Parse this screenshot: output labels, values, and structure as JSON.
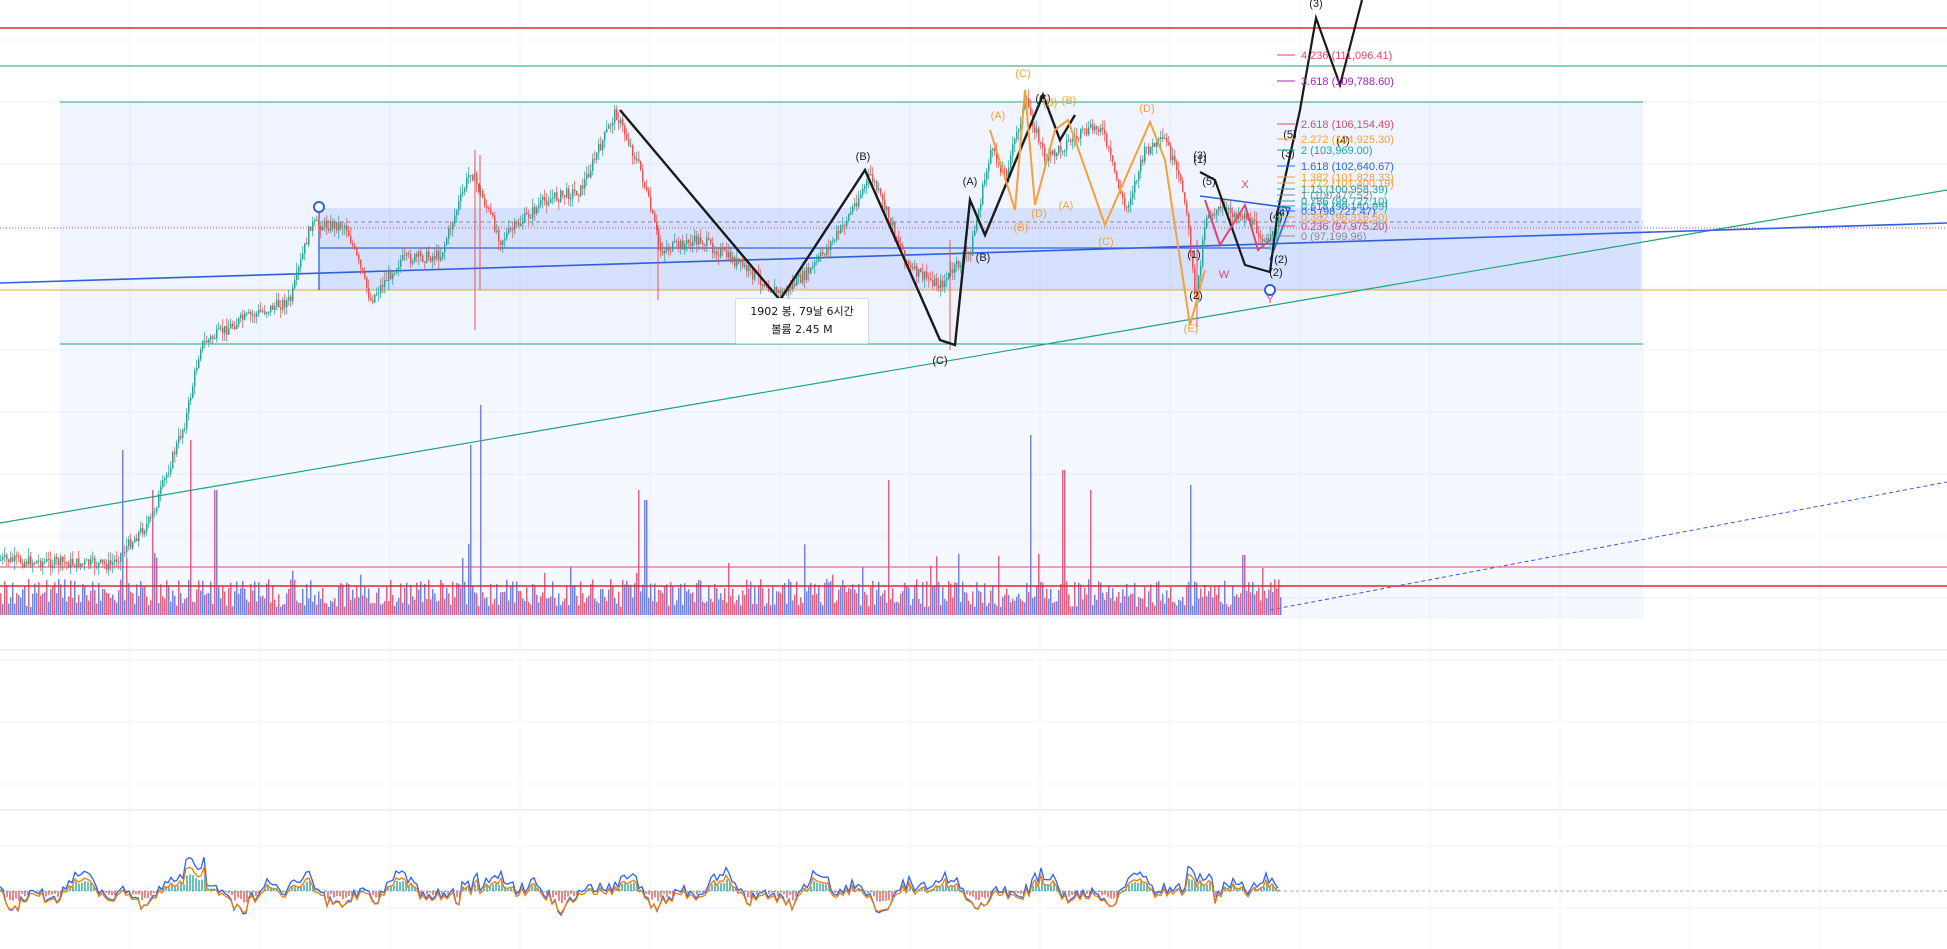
{
  "colors": {
    "background": "#ffffff",
    "grid": "#f0f3fa",
    "up": "#26a69a",
    "down": "#ef5350",
    "vol_up": "#5b6ee1",
    "vol_down": "#e0476b",
    "zone_fill": "#2962ff",
    "wave_black": "#1a1a1a",
    "wave_orange": "#f5a13a",
    "wave_pink": "#e0476b",
    "channel_blue": "#2f5fe0",
    "green_line": "#1ea37a",
    "red_line": "#d32f2f",
    "orange_line": "#f5a623"
  },
  "tooltip": {
    "line1": "1902 봉, 79날 6시간",
    "line2": "볼륨 2.45 M"
  },
  "chart_data": {
    "type": "candlestick",
    "title": "",
    "fib_levels": [
      {
        "ratio": "4.236",
        "price": "111,096.41",
        "color": "#e0476b"
      },
      {
        "ratio": "3.618",
        "price": "109,788.60",
        "color": "#9c27b0"
      },
      {
        "ratio": "2.618",
        "price": "106,154.49",
        "color": "#e0476b"
      },
      {
        "ratio": "2.272",
        "price": "104,925.30",
        "color": "#f5a13a"
      },
      {
        "ratio": "2",
        "price": "103,969.00",
        "color": "#1ea3a3"
      },
      {
        "ratio": "1.618",
        "price": "102,640.67",
        "color": "#2962ff"
      },
      {
        "ratio": "1.382",
        "price": "101,828.33",
        "color": "#f5a13a"
      },
      {
        "ratio": "1.272",
        "price": "101,400.19",
        "color": "#f5a13a"
      },
      {
        "ratio": "1.13",
        "price": "100,958.39",
        "color": "#1ea3a3"
      },
      {
        "ratio": "1",
        "price": "100,477.52",
        "color": "#8a8a8a"
      },
      {
        "ratio": "0.786",
        "price": "99,727.10",
        "color": "#1ea3a3"
      },
      {
        "ratio": "0.618",
        "price": "99,140.99",
        "color": "#1ea3a3"
      },
      {
        "ratio": "0.5",
        "price": "98,727.47",
        "color": "#2962ff"
      },
      {
        "ratio": "0.382",
        "price": "98,316.50",
        "color": "#f5a13a"
      },
      {
        "ratio": "0.236",
        "price": "97,975.20",
        "color": "#e0476b"
      },
      {
        "ratio": "0",
        "price": "97,199.96",
        "color": "#8a8a8a"
      }
    ],
    "wave_labels_black": [
      "(B)",
      "(A)",
      "(B)",
      "(C)",
      "(C)",
      "(3)",
      "(1)",
      "(5)",
      "(2)",
      "(4)",
      "(3)",
      "(4)",
      "(5)",
      "(3)",
      "(2)",
      "(1)",
      "(2)",
      "(4)"
    ],
    "wave_labels_orange": [
      "(C)",
      "(A)",
      "(B)",
      "(B)",
      "(D)",
      "(A)",
      "(C)",
      "(D)",
      "(E)",
      "(B)"
    ],
    "wave_labels_pink": [
      "X",
      "W",
      "Y"
    ],
    "grid": true
  }
}
